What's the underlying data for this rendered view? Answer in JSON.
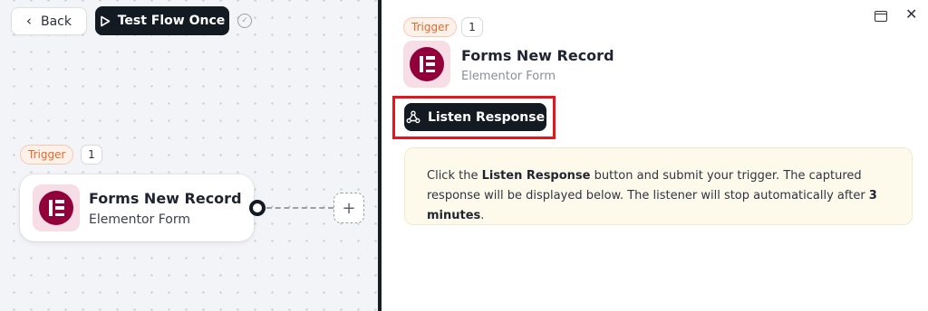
{
  "toolbar": {
    "back_label": "Back",
    "back_icon": "chevron-left-icon",
    "test_label": "Test Flow Once",
    "test_icon": "play-icon",
    "status_icon": "check-circle-icon"
  },
  "canvas": {
    "trigger_badge": "Trigger",
    "count": "1",
    "node": {
      "title": "Forms New Record",
      "subtitle": "Elementor Form",
      "icon": "elementor-icon"
    },
    "add_symbol": "+"
  },
  "panel": {
    "trigger_badge": "Trigger",
    "count": "1",
    "title": "Forms New Record",
    "subtitle": "Elementor Form",
    "window_icon": "window-icon",
    "close_symbol": "✕",
    "listen_label": "Listen Response",
    "listen_icon": "webhook-icon",
    "info": {
      "part1": "Click the ",
      "bold1": "Listen Response",
      "part2": " button and submit your trigger. The captured response will be displayed below. The listener will stop automatically after ",
      "bold2": "3 minutes",
      "part3": "."
    }
  },
  "colors": {
    "dark": "#141a22",
    "accent_orange": "#e26a2c",
    "elementor": "#92003b",
    "highlight": "#e3161b",
    "info_bg": "#fdfaec"
  }
}
